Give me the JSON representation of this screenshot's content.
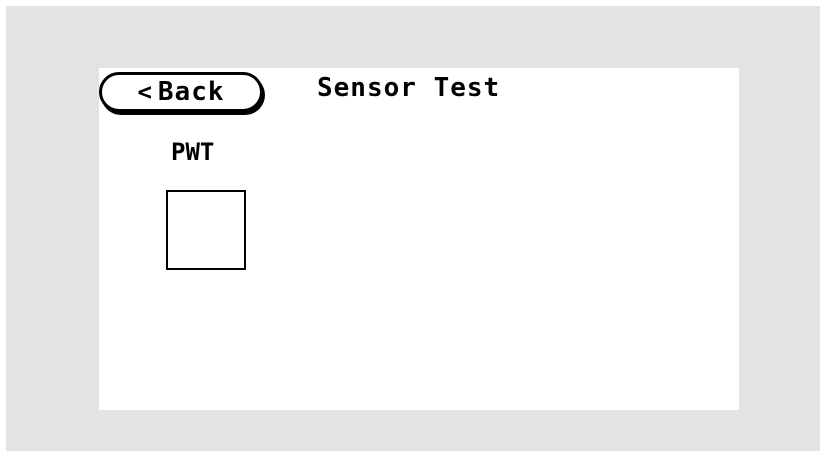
{
  "header": {
    "back_label": "Back",
    "back_icon": "chevron-left-icon",
    "back_glyph": "<",
    "title": "Sensor Test"
  },
  "sensor": {
    "label": "PWT",
    "active": false
  }
}
